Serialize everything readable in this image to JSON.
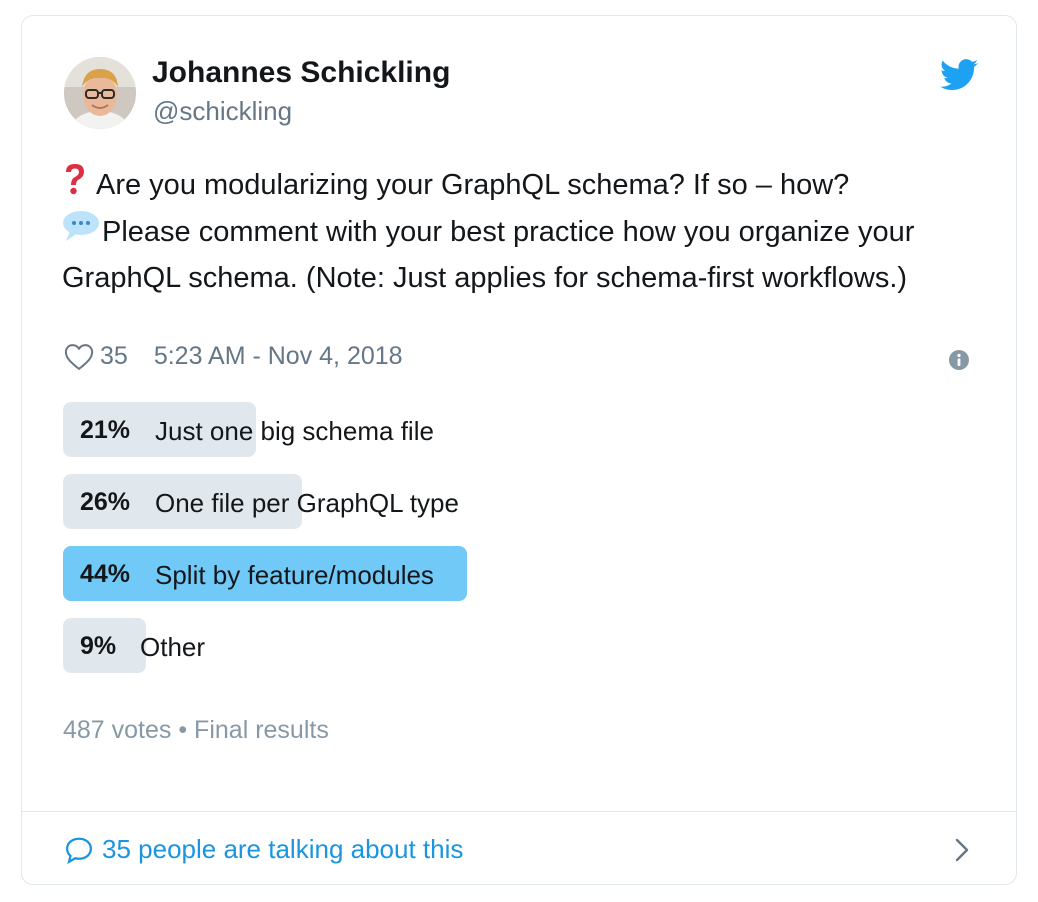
{
  "author": {
    "name": "Johannes Schickling",
    "handle": "@schickling"
  },
  "tweet": {
    "line1": "Are you modularizing your GraphQL schema? If so – how?",
    "line2": "Please comment with your best practice how you organize your GraphQL schema. (Note: Just applies for schema-first workflows.)",
    "emoji_question": "❓",
    "emoji_bubble": "💬"
  },
  "meta": {
    "likes": "35",
    "timestamp": "5:23 AM - Nov 4, 2018"
  },
  "poll": {
    "options": [
      {
        "percent": "21%",
        "value": 21,
        "label": "Just one big schema file",
        "winner": false
      },
      {
        "percent": "26%",
        "value": 26,
        "label": "One file per GraphQL type",
        "winner": false
      },
      {
        "percent": "44%",
        "value": 44,
        "label": "Split by feature/modules",
        "winner": true
      },
      {
        "percent": "9%",
        "value": 9,
        "label": "Other",
        "winner": false
      }
    ],
    "summary": "487 votes • Final results"
  },
  "footer": {
    "link": "35 people are talking about this"
  },
  "icons": {
    "brand": "twitter-bird-icon",
    "like": "heart-icon",
    "info": "info-icon",
    "reply": "speech-bubble-icon",
    "chevron": "chevron-right-icon"
  },
  "colors": {
    "accent": "#1da1f2",
    "link": "#1b95e0",
    "poll_bar": "#e1e8ed",
    "poll_winner": "#71c9f8",
    "muted": "#657786"
  }
}
